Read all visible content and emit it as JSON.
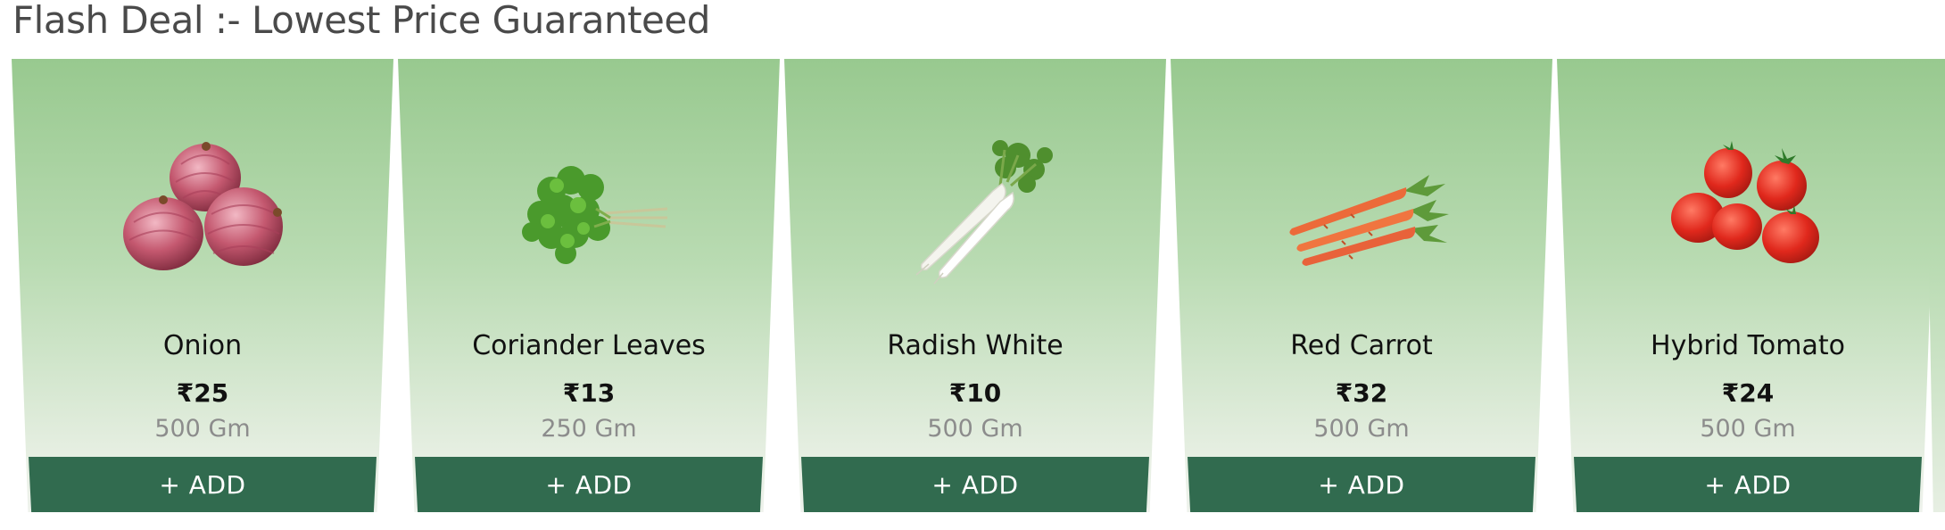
{
  "section": {
    "title": "Flash Deal :- Lowest Price Guaranteed"
  },
  "theme": {
    "card_gradient_top": "#98c98f",
    "card_gradient_bottom": "#eef2ec",
    "button_color": "#316b4f",
    "button_text_color": "#ffffff"
  },
  "products": [
    {
      "name": "Onion",
      "price": "₹25",
      "quantity": "500 Gm",
      "add_label": "+ ADD",
      "icon": "onion-icon"
    },
    {
      "name": "Coriander Leaves",
      "price": "₹13",
      "quantity": "250 Gm",
      "add_label": "+ ADD",
      "icon": "coriander-icon"
    },
    {
      "name": "Radish White",
      "price": "₹10",
      "quantity": "500 Gm",
      "add_label": "+ ADD",
      "icon": "radish-icon"
    },
    {
      "name": "Red Carrot",
      "price": "₹32",
      "quantity": "500 Gm",
      "add_label": "+ ADD",
      "icon": "carrot-icon"
    },
    {
      "name": "Hybrid Tomato",
      "price": "₹24",
      "quantity": "500 Gm",
      "add_label": "+ ADD",
      "icon": "tomato-icon"
    }
  ]
}
